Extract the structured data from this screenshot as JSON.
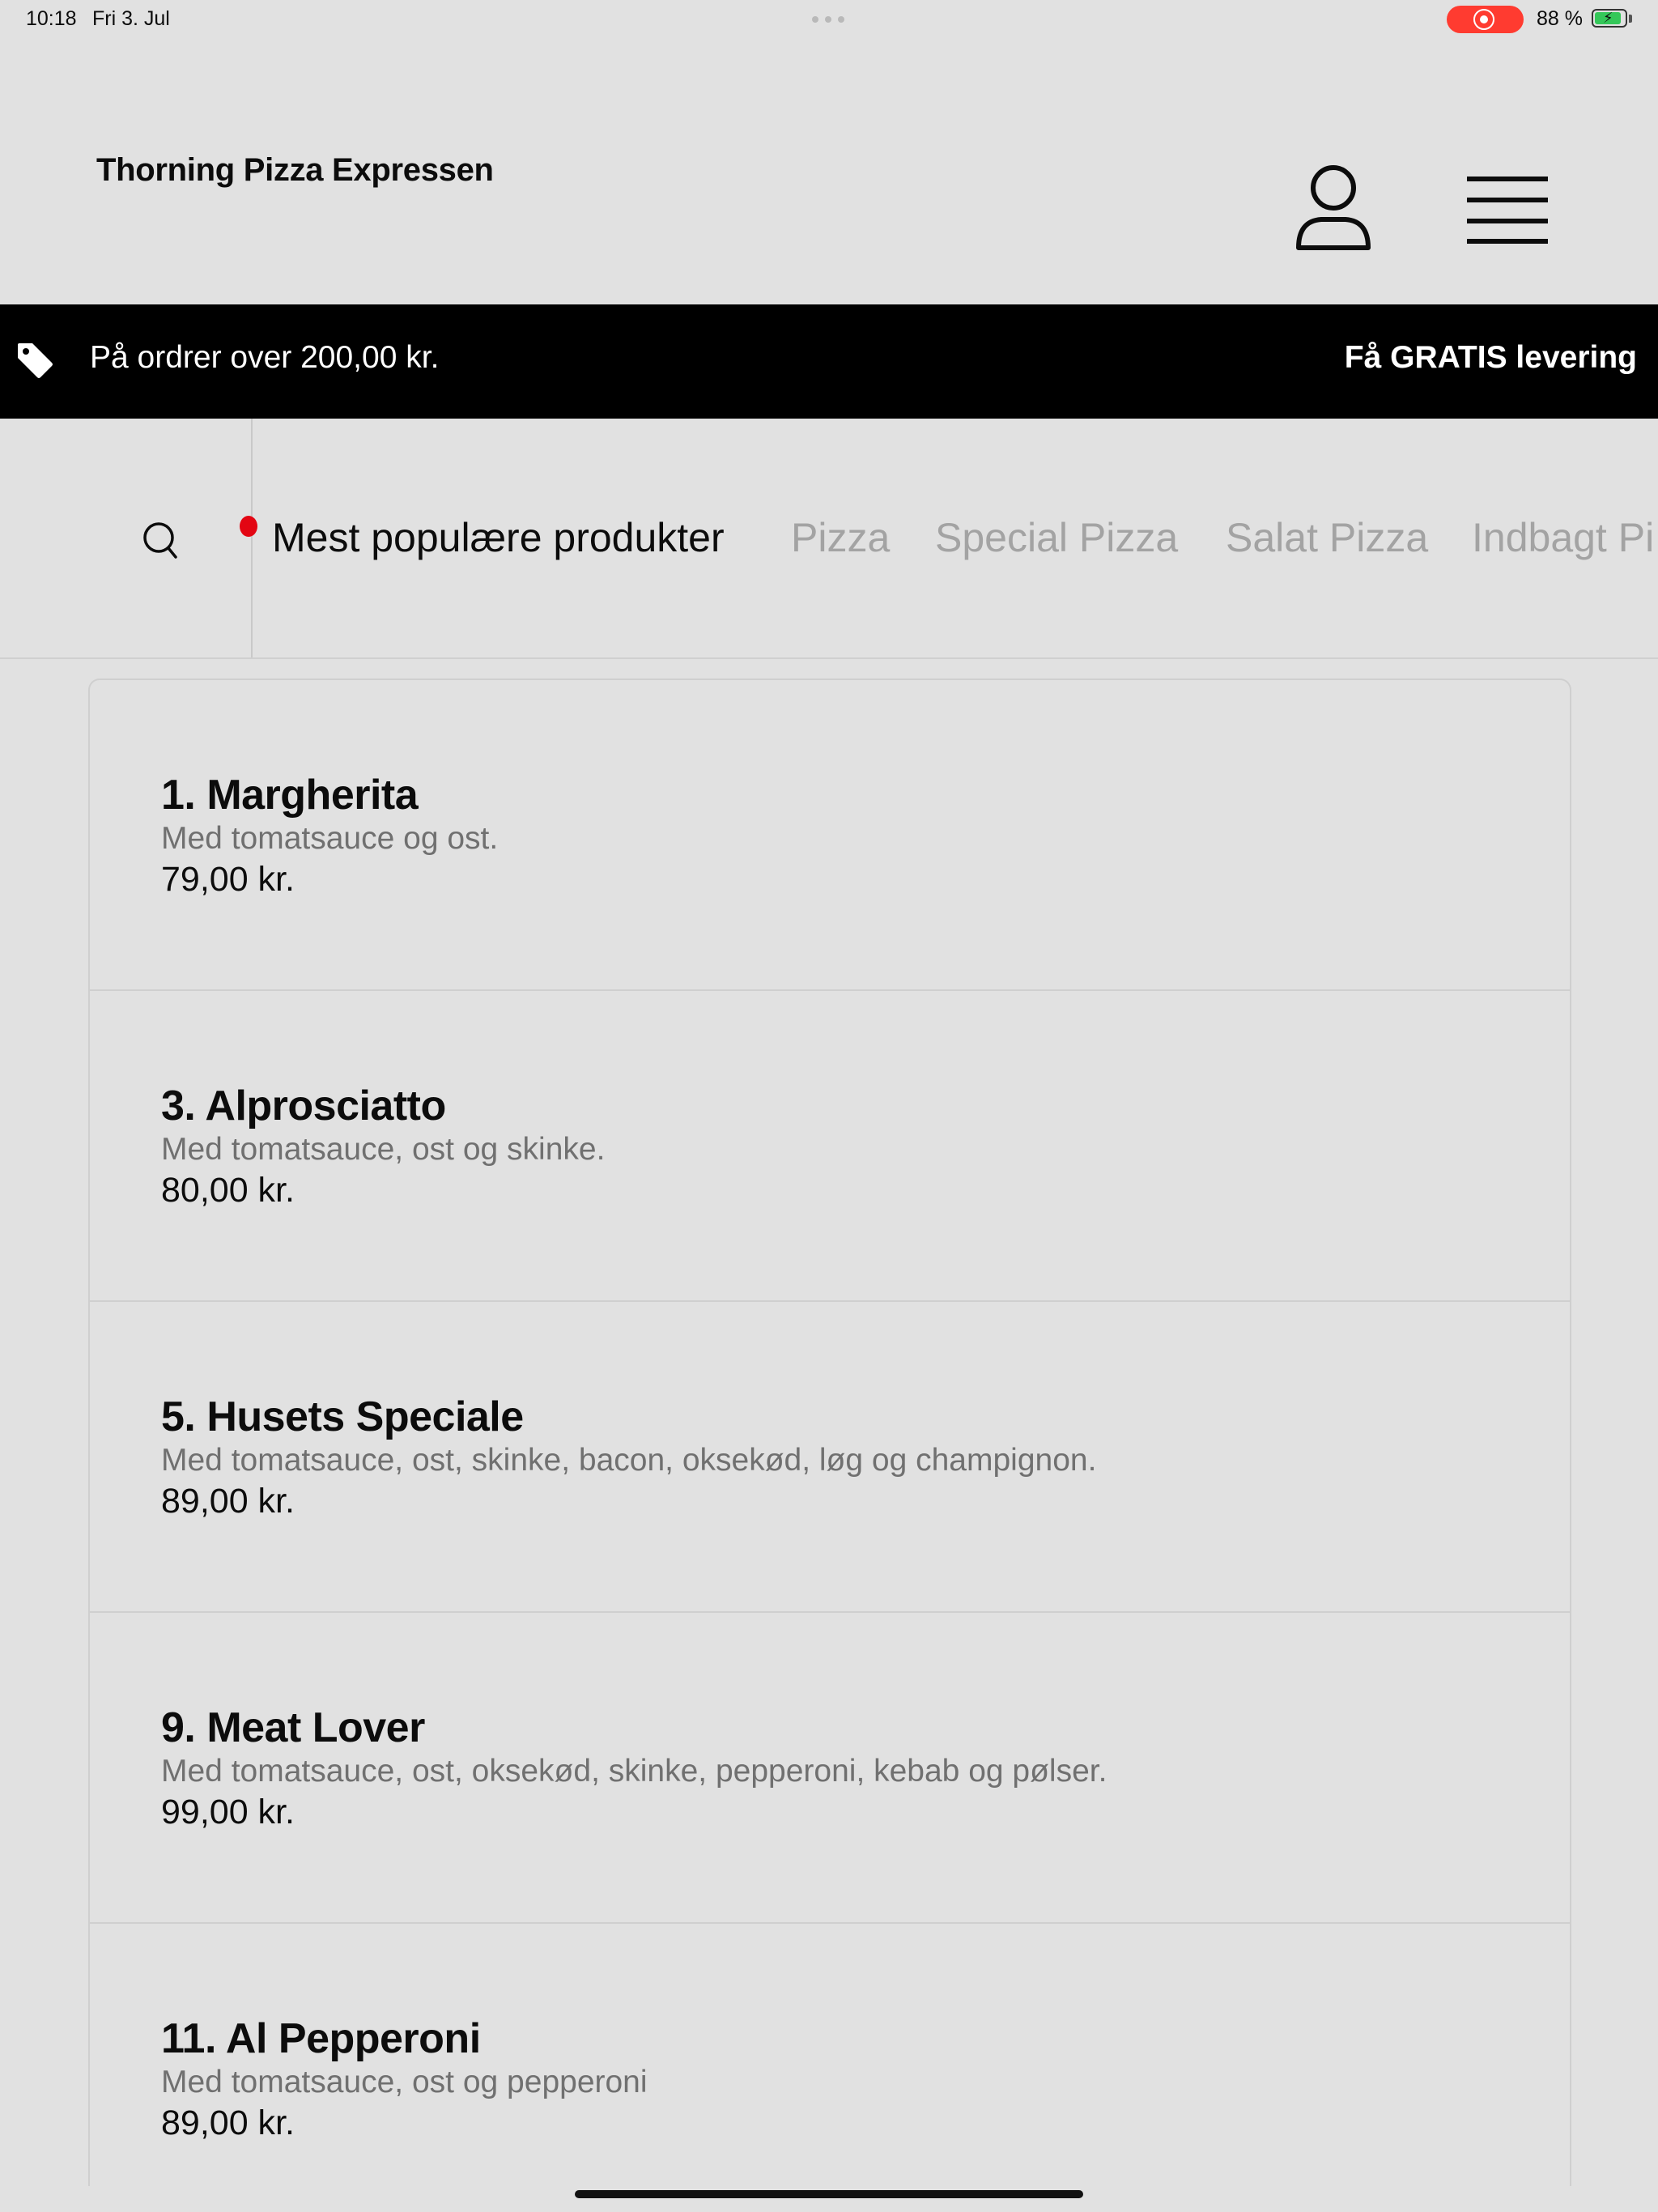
{
  "status_bar": {
    "time": "10:18",
    "date": "Fri 3. Jul",
    "battery_percent": "88 %",
    "battery_level": 0.88,
    "charging": true,
    "recording": true,
    "record_color": "#ff3b30"
  },
  "header": {
    "brand": "Thorning Pizza Expressen",
    "account_icon": "user-icon",
    "menu_icon": "hamburger-menu-icon"
  },
  "promo": {
    "icon": "tag-icon",
    "left_text": "På ordrer over 200,00 kr.",
    "right_text": "Få GRATIS levering"
  },
  "categories": {
    "search_icon": "search-icon",
    "tabs": [
      {
        "label": "Mest populære produkter",
        "active": true
      },
      {
        "label": "Pizza",
        "active": false
      },
      {
        "label": "Special Pizza",
        "active": false
      },
      {
        "label": "Salat Pizza",
        "active": false
      },
      {
        "label": "Indbagt Pi",
        "active": false
      }
    ]
  },
  "products": [
    {
      "name": "1. Margherita",
      "description": "Med tomatsauce og ost.",
      "price": "79,00 kr."
    },
    {
      "name": "3. Alprosciatto",
      "description": "Med tomatsauce, ost og skinke.",
      "price": "80,00 kr."
    },
    {
      "name": "5. Husets Speciale",
      "description": "Med tomatsauce, ost, skinke, bacon, oksekød, løg og champignon.",
      "price": "89,00 kr."
    },
    {
      "name": "9. Meat Lover",
      "description": "Med tomatsauce, ost, oksekød, skinke, pepperoni, kebab og pølser.",
      "price": "99,00 kr."
    },
    {
      "name": "11. Al Pepperoni",
      "description": "Med tomatsauce, ost og pepperoni",
      "price": "89,00 kr."
    }
  ],
  "colors": {
    "background": "#e1e1e1",
    "promo_background": "#000000",
    "accent_red": "#e30613",
    "muted_text": "#707070",
    "inactive_tab": "#a3a3a3"
  }
}
